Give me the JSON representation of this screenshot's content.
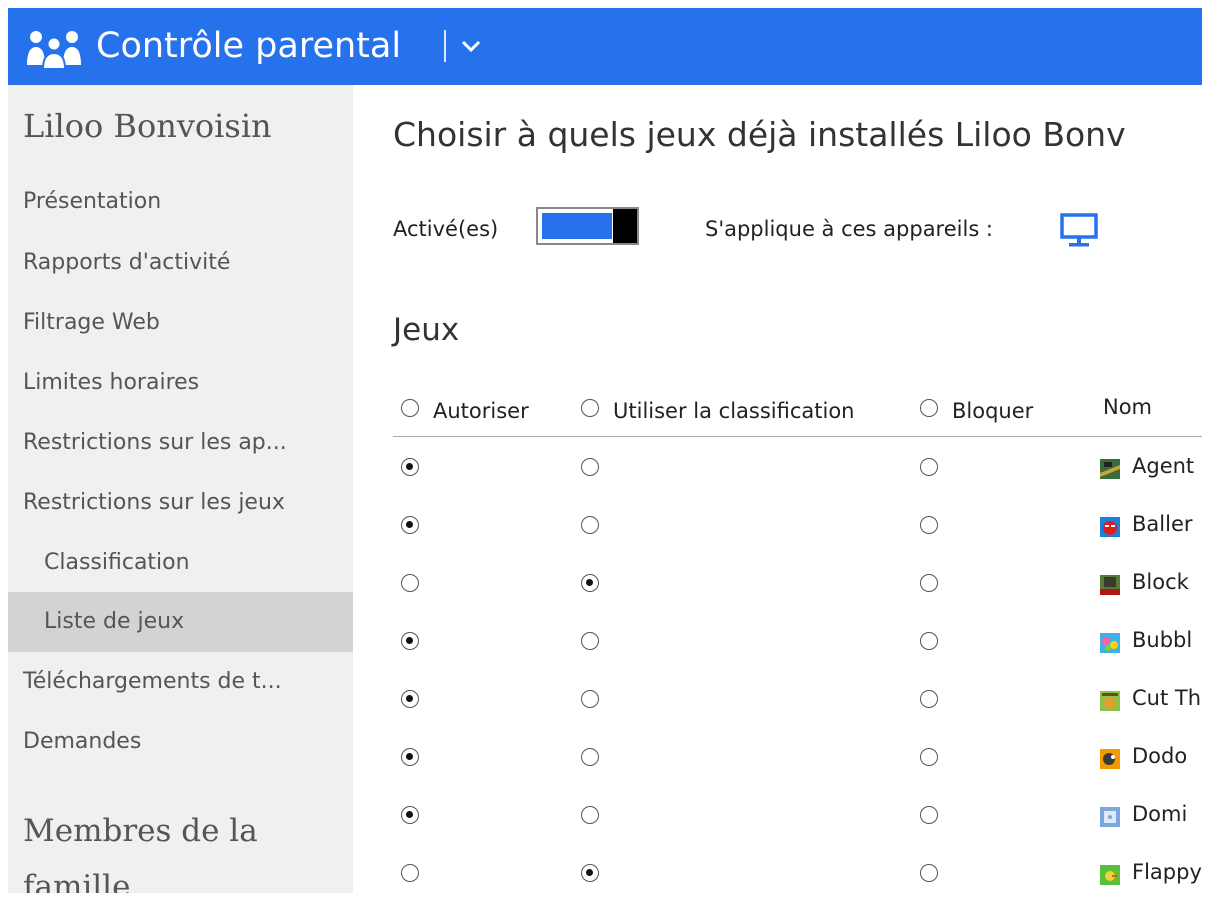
{
  "app": {
    "title": "Contrôle parental"
  },
  "sidebar": {
    "child_name": "Liloo Bonvoisin",
    "items": [
      {
        "label": "Présentation"
      },
      {
        "label": "Rapports d'activité"
      },
      {
        "label": "Filtrage Web"
      },
      {
        "label": "Limites horaires"
      },
      {
        "label": "Restrictions sur les ap..."
      },
      {
        "label": "Restrictions sur les jeux"
      },
      {
        "label": "Classification"
      },
      {
        "label": "Liste de jeux"
      },
      {
        "label": "Téléchargements de t..."
      },
      {
        "label": "Demandes"
      }
    ],
    "active_item": "Liste de jeux",
    "family_title": "Membres de la famille"
  },
  "main": {
    "heading": "Choisir à quels jeux déjà installés Liloo Bonv",
    "enabled_label": "Activé(es)",
    "toggle_on": true,
    "applies_label": "S'applique à ces appareils :",
    "section_title": "Jeux",
    "columns": {
      "allow": "Autoriser",
      "rating": "Utiliser la classification",
      "block": "Bloquer",
      "name": "Nom"
    },
    "games": [
      {
        "name": "Agent",
        "choice": "allow"
      },
      {
        "name": "Baller",
        "choice": "allow"
      },
      {
        "name": "Block",
        "choice": "rating"
      },
      {
        "name": "Bubbl",
        "choice": "allow"
      },
      {
        "name": "Cut Th",
        "choice": "allow"
      },
      {
        "name": "Dodo",
        "choice": "allow"
      },
      {
        "name": "Domi",
        "choice": "allow"
      },
      {
        "name": "Flappy",
        "choice": "rating"
      }
    ]
  },
  "colors": {
    "accent": "#2672ec",
    "sidebar_bg": "#f0f0f0",
    "active_bg": "#d3d3d3"
  },
  "icons": {
    "app_logo": "family-icon",
    "devices": "monitor-icon",
    "menu": "chevron-down-icon"
  }
}
